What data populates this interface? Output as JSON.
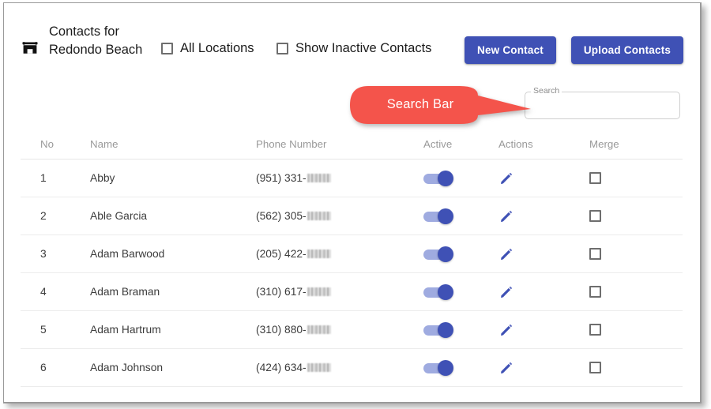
{
  "window": {
    "border_color": "#9a9a9a"
  },
  "header": {
    "store_icon": "storefront-icon",
    "title": "Contacts for Redondo Beach",
    "checkboxes": [
      {
        "name": "all-locations",
        "label": "All Locations",
        "checked": false
      },
      {
        "name": "show-inactive-contacts",
        "label": "Show Inactive Contacts",
        "checked": false
      }
    ],
    "buttons": [
      {
        "name": "new-contact-button",
        "label": "New Contact",
        "color": "#3f51b5"
      },
      {
        "name": "upload-contacts-button",
        "label": "Upload Contacts",
        "color": "#3f51b5"
      }
    ]
  },
  "search": {
    "label": "Search",
    "value": "",
    "placeholder": ""
  },
  "annotation": {
    "text": "Search Bar",
    "color": "#f4544b",
    "shape": "rounded-pill-with-right-arrow",
    "points_to": "search-input"
  },
  "table": {
    "columns": [
      "No",
      "Name",
      "Phone Number",
      "Active",
      "Actions",
      "Merge"
    ],
    "rows": [
      {
        "no": "1",
        "name": "Abby",
        "phone": "(951) 331-",
        "phone_redacted": true,
        "active": true,
        "action_icon": "pencil-icon",
        "merge": false
      },
      {
        "no": "2",
        "name": "Able Garcia",
        "phone": "(562) 305-",
        "phone_redacted": true,
        "active": true,
        "action_icon": "pencil-icon",
        "merge": false
      },
      {
        "no": "3",
        "name": "Adam Barwood",
        "phone": "(205) 422-",
        "phone_redacted": true,
        "active": true,
        "action_icon": "pencil-icon",
        "merge": false
      },
      {
        "no": "4",
        "name": "Adam Braman",
        "phone": "(310) 617-",
        "phone_redacted": true,
        "active": true,
        "action_icon": "pencil-icon",
        "merge": false
      },
      {
        "no": "5",
        "name": "Adam Hartrum",
        "phone": "(310) 880-",
        "phone_redacted": true,
        "active": true,
        "action_icon": "pencil-icon",
        "merge": false
      },
      {
        "no": "6",
        "name": "Adam Johnson",
        "phone": "(424) 634-",
        "phone_redacted": true,
        "active": true,
        "action_icon": "pencil-icon",
        "merge": false
      }
    ]
  },
  "colors": {
    "accent": "#3f51b5",
    "toggle_track": "#9fabe0",
    "annotation": "#f4544b",
    "header_text": "#9a9a9a",
    "row_divider": "#ececec"
  }
}
